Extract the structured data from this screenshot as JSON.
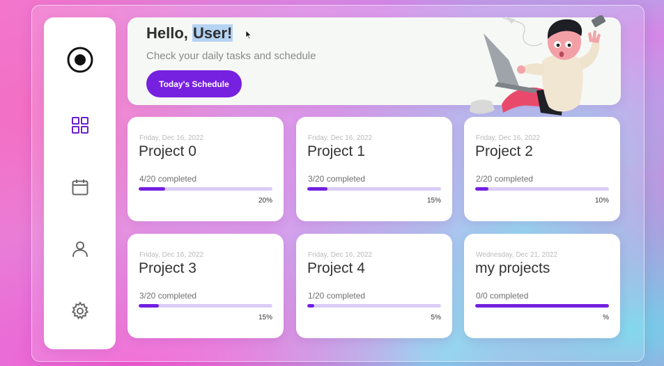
{
  "header": {
    "greeting_prefix": "Hello,",
    "greeting_name": "User!",
    "subtitle": "Check your daily tasks and schedule",
    "schedule_button_label": "Today's Schedule"
  },
  "sidebar": {
    "items": [
      {
        "icon": "logo-circle-icon"
      },
      {
        "icon": "grid-dashboard-icon",
        "active": true
      },
      {
        "icon": "calendar-icon"
      },
      {
        "icon": "user-icon"
      },
      {
        "icon": "gear-icon"
      }
    ]
  },
  "projects": [
    {
      "date": "Friday, Dec 16, 2022",
      "title": "Project 0",
      "completed": "4/20 completed",
      "percent_label": "20%",
      "progress": 0.2
    },
    {
      "date": "Friday, Dec 16, 2022",
      "title": "Project 1",
      "completed": "3/20 completed",
      "percent_label": "15%",
      "progress": 0.15
    },
    {
      "date": "Friday, Dec 16, 2022",
      "title": "Project 2",
      "completed": "2/20 completed",
      "percent_label": "10%",
      "progress": 0.1
    },
    {
      "date": "Friday, Dec 16, 2022",
      "title": "Project 3",
      "completed": "3/20 completed",
      "percent_label": "15%",
      "progress": 0.15
    },
    {
      "date": "Friday, Dec 16, 2022",
      "title": "Project 4",
      "completed": "1/20 completed",
      "percent_label": "5%",
      "progress": 0.05
    },
    {
      "date": "Wednesday, Dec 21, 2022",
      "title": "my projects",
      "completed": "0/0 completed",
      "percent_label": "%",
      "progress": 1.0
    }
  ],
  "colors": {
    "accent": "#7620e0",
    "track": "#d9cdf6",
    "card_bg": "#ffffff"
  }
}
